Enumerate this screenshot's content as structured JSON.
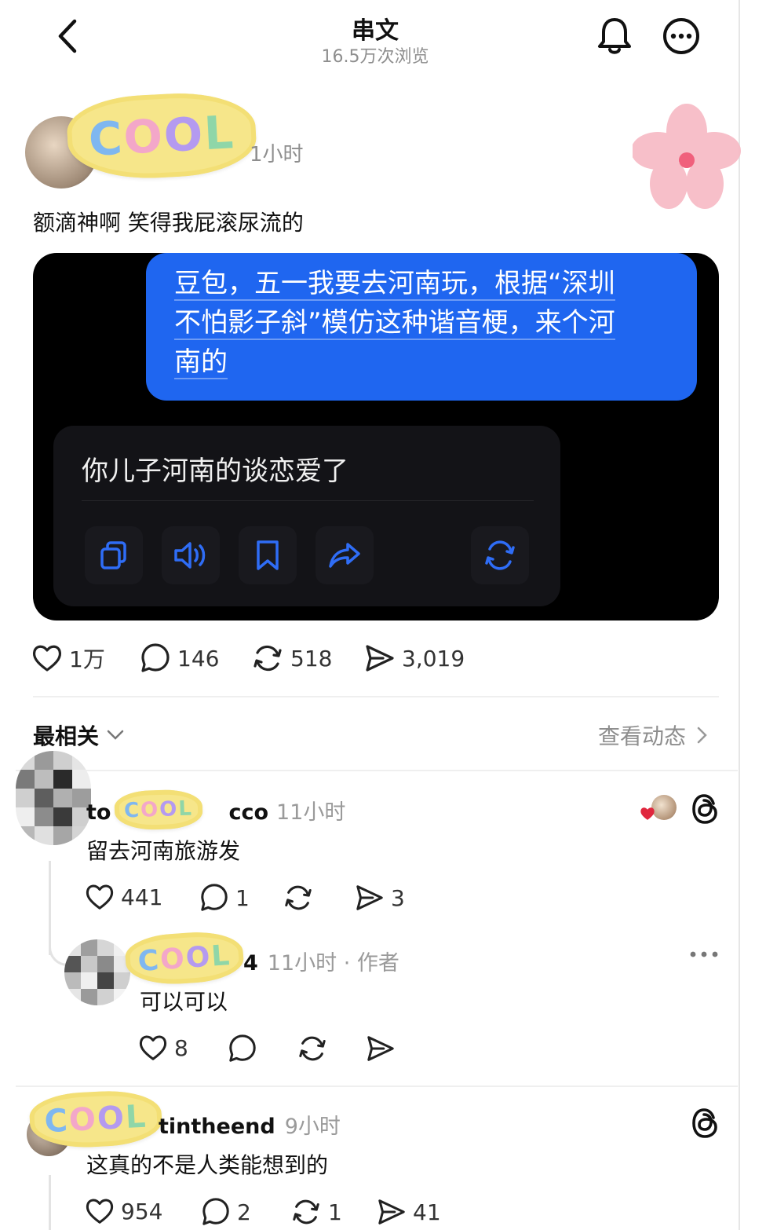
{
  "header": {
    "title": "串文",
    "views": "16.5万次浏览"
  },
  "post": {
    "time_fragment": "1小时",
    "text": "额滴神啊 笑得我屁滚尿流的",
    "sticker_text": "COOL",
    "chat": {
      "user_message_lines": [
        "豆包，五一我要去河南玩，根据“深圳",
        "不怕影子斜”模仿这种谐音梗，来个河",
        "南的"
      ],
      "bot_reply": "你儿子河南的谈恋爱了",
      "tools": [
        "copy-icon",
        "speaker-icon",
        "bookmark-icon",
        "share-icon",
        "refresh-icon"
      ]
    },
    "stats": {
      "likes": "1万",
      "comments": "146",
      "reposts": "518",
      "shares": "3,019"
    }
  },
  "comments_header": {
    "sort_label": "最相关",
    "activity_label": "查看动态"
  },
  "comments": [
    {
      "username_start": "to",
      "username_end": "cco",
      "time": "11小时",
      "text": "留去河南旅游发",
      "stats": {
        "likes": "441",
        "comments": "1",
        "shares": "3"
      }
    },
    {
      "username_end": "4",
      "time": "11小时 · 作者",
      "text": "可以可以",
      "stats": {
        "likes": "8"
      }
    },
    {
      "username_end": "tintheend",
      "time": "9小时",
      "text": "这真的不是人类能想到的",
      "stats": {
        "likes": "954",
        "comments": "2",
        "reposts": "1",
        "shares": "41"
      }
    }
  ],
  "colors": {
    "accent_blue": "#1f66f0",
    "muted": "#8e8e8e",
    "heart_red": "#e0263d"
  }
}
